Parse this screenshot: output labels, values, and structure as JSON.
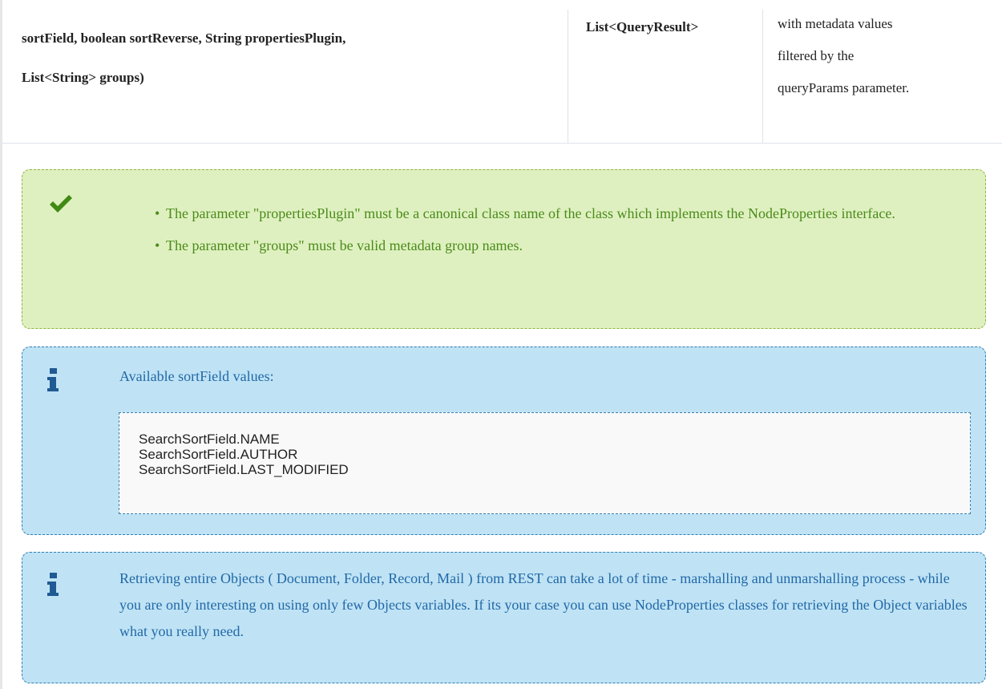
{
  "table": {
    "signature_lines": [
      "sortField, boolean sortReverse, String propertiesPlugin,",
      "List<String> groups)"
    ],
    "return_type": "List<QueryResult>",
    "description_lines": [
      "with metadata values",
      "filtered by the",
      "queryParams parameter."
    ]
  },
  "success_note": {
    "icon": "check-icon",
    "items": [
      "The parameter \"propertiesPlugin\" must be a canonical class name of the class which implements the NodeProperties interface.",
      "The parameter \"groups\" must be valid metadata group names."
    ],
    "color": "#4a8b1a"
  },
  "info_note_1": {
    "icon": "info-icon",
    "title": "Available sortField values:",
    "code_lines": [
      "SearchSortField.NAME",
      "SearchSortField.AUTHOR",
      "SearchSortField.LAST_MODIFIED"
    ],
    "color": "#2268a7"
  },
  "info_note_2": {
    "icon": "info-icon",
    "text": "Retrieving entire Objects ( Document, Folder, Record, Mail ) from REST can take a lot of time - marshalling and unmarshalling process - while you are only interesting on using only few Objects variables. If its your case you can use NodeProperties classes for retrieving the Object variables what you really need."
  }
}
